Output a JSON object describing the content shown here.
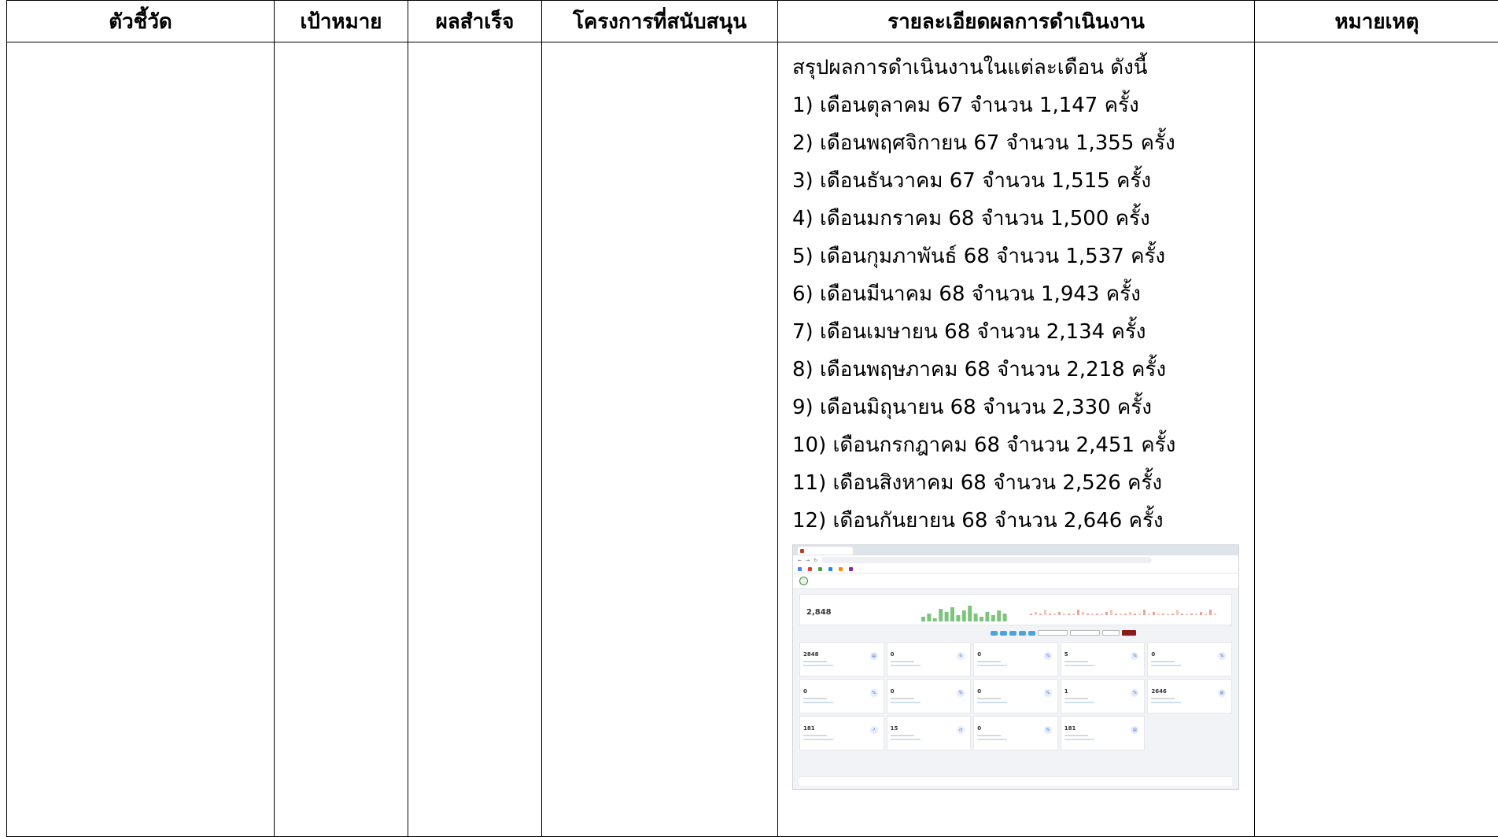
{
  "table": {
    "headers": [
      "ตัวชี้วัด",
      "เป้าหมาย",
      "ผลสำเร็จ",
      "โครงการที่สนับสนุน",
      "รายละเอียดผลการดำเนินงาน",
      "หมายเหตุ"
    ],
    "detail_lines": [
      "สรุปผลการดำเนินงานในแต่ละเดือน ดังนี้",
      "1) เดือนตุลาคม 67 จำนวน 1,147 ครั้ง",
      "2) เดือนพฤศจิกายน 67 จำนวน 1,355 ครั้ง",
      "3) เดือนธันวาคม 67 จำนวน 1,515 ครั้ง",
      "4) เดือนมกราคม 68 จำนวน 1,500 ครั้ง",
      "5) เดือนกุมภาพันธ์ 68 จำนวน 1,537 ครั้ง",
      "6) เดือนมีนาคม 68 จำนวน 1,943 ครั้ง",
      "7) เดือนเมษายน 68  จำนวน 2,134 ครั้ง",
      "8) เดือนพฤษภาคม 68 จำนวน 2,218 ครั้ง",
      "9) เดือนมิถุนายน 68 จำนวน 2,330 ครั้ง",
      "10) เดือนกรกฎาคม 68 จำนวน 2,451 ครั้ง",
      "11) เดือนสิงหาคม 68 จำนวน 2,526 ครั้ง",
      "12) เดือนกันยายน 68 จำนวน 2,646 ครั้ง"
    ]
  },
  "screenshot": {
    "hero_value": "2,848",
    "cards": [
      {
        "value": "2848",
        "icon": "document-icon"
      },
      {
        "value": "0",
        "icon": "refresh-icon"
      },
      {
        "value": "0",
        "icon": "percent-icon"
      },
      {
        "value": "5",
        "icon": "percent-icon"
      },
      {
        "value": "0",
        "icon": "percent-icon"
      },
      {
        "value": "0",
        "icon": "percent-icon"
      },
      {
        "value": "0",
        "icon": "percent-icon"
      },
      {
        "value": "0",
        "icon": "percent-icon"
      },
      {
        "value": "1",
        "icon": "percent-icon"
      },
      {
        "value": "2646",
        "icon": "chart-icon"
      },
      {
        "value": "181",
        "icon": "trend-icon"
      },
      {
        "value": "15",
        "icon": "clock-icon"
      },
      {
        "value": "0",
        "icon": "percent-icon"
      },
      {
        "value": "181",
        "icon": "document-icon"
      }
    ],
    "mini_chart_1": [
      3,
      5,
      2,
      8,
      6,
      9,
      4,
      7,
      10,
      5,
      3,
      6,
      4,
      7,
      5
    ],
    "mini_chart_2_colors": [
      "#e8a598",
      "#f4c6bb"
    ],
    "bar_color": "#7cc47c",
    "accent": "#8b1a1a"
  }
}
